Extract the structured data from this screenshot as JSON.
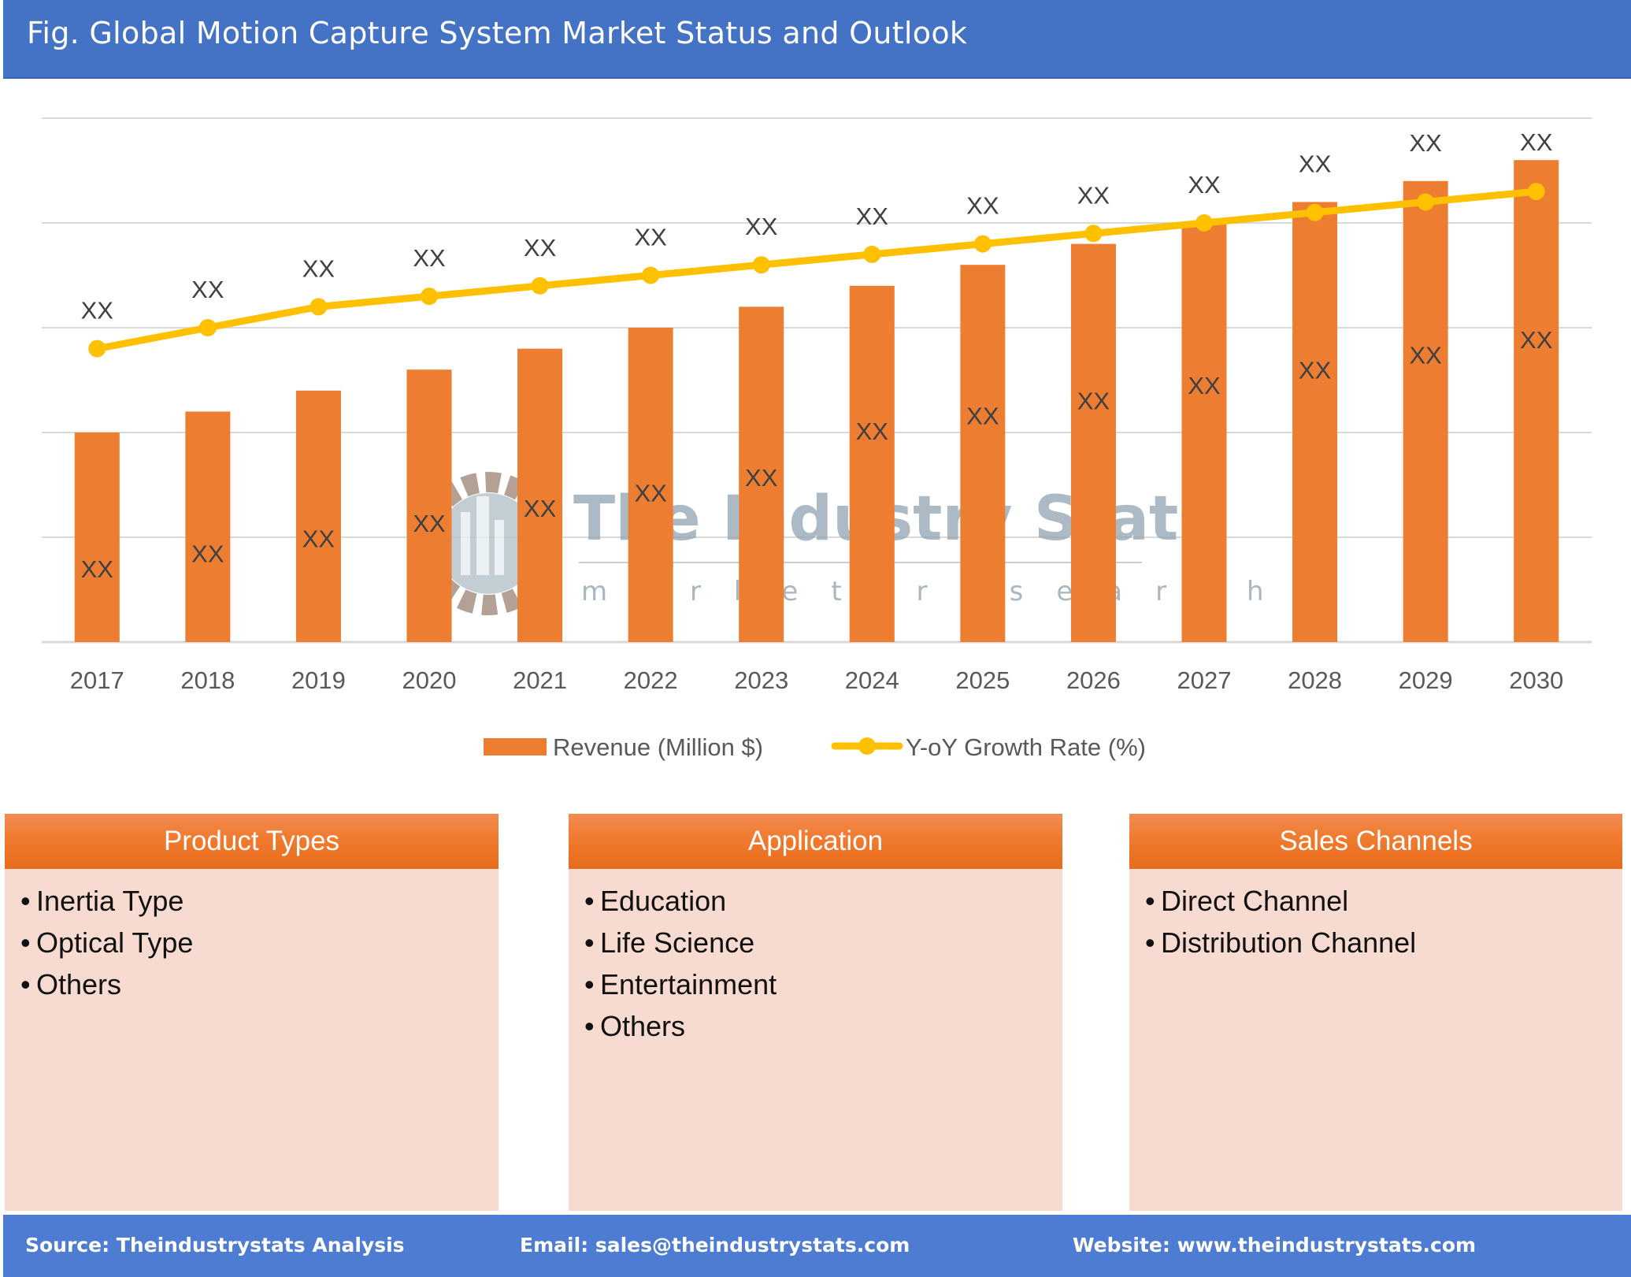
{
  "header": {
    "title": "Fig. Global Motion Capture System Market Status and Outlook"
  },
  "colors": {
    "header_bg": "#4472c4",
    "bar": "#ed7d31",
    "line": "#ffc000",
    "grid": "#d9d9d9",
    "box_bg": "#f8dbd0",
    "footer_bg": "#4d7cd2"
  },
  "watermark": {
    "title": "The Industry Stats",
    "subtitle": "market research"
  },
  "chart_data": {
    "type": "bar",
    "title": "",
    "xlabel": "",
    "ylabel": "",
    "categories": [
      "2017",
      "2018",
      "2019",
      "2020",
      "2021",
      "2022",
      "2023",
      "2024",
      "2025",
      "2026",
      "2027",
      "2028",
      "2029",
      "2030"
    ],
    "ylim": [
      0,
      5
    ],
    "y_unit_note": "axis has no tick labels; values in gridline units",
    "gridlines": [
      1,
      2,
      3,
      4,
      5
    ],
    "grid": true,
    "legend_position": "bottom",
    "series": [
      {
        "name": "Revenue (Million $)",
        "type": "bar",
        "values": [
          2.0,
          2.2,
          2.4,
          2.6,
          2.8,
          3.0,
          3.2,
          3.4,
          3.6,
          3.8,
          4.0,
          4.2,
          4.4,
          4.6
        ],
        "data_labels": [
          "XX",
          "XX",
          "XX",
          "XX",
          "XX",
          "XX",
          "XX",
          "XX",
          "XX",
          "XX",
          "XX",
          "XX",
          "XX",
          "XX"
        ]
      },
      {
        "name": "Y-oY Growth Rate (%)",
        "type": "line",
        "values": [
          2.8,
          3.0,
          3.2,
          3.3,
          3.4,
          3.5,
          3.6,
          3.7,
          3.8,
          3.9,
          4.0,
          4.1,
          4.2,
          4.3
        ],
        "data_labels": [
          "XX",
          "XX",
          "XX",
          "XX",
          "XX",
          "XX",
          "XX",
          "XX",
          "XX",
          "XX",
          "XX",
          "XX",
          "XX",
          "XX"
        ]
      }
    ]
  },
  "boxes": [
    {
      "title": "Product Types",
      "items": [
        "Inertia Type",
        "Optical Type",
        "Others"
      ]
    },
    {
      "title": "Application",
      "items": [
        "Education",
        "Life Science",
        "Entertainment",
        "Others"
      ]
    },
    {
      "title": "Sales Channels",
      "items": [
        "Direct Channel",
        "Distribution Channel"
      ]
    }
  ],
  "footer": {
    "source": "Source: Theindustrystats Analysis",
    "email": "Email: sales@theindustrystats.com",
    "website": "Website: www.theindustrystats.com"
  }
}
